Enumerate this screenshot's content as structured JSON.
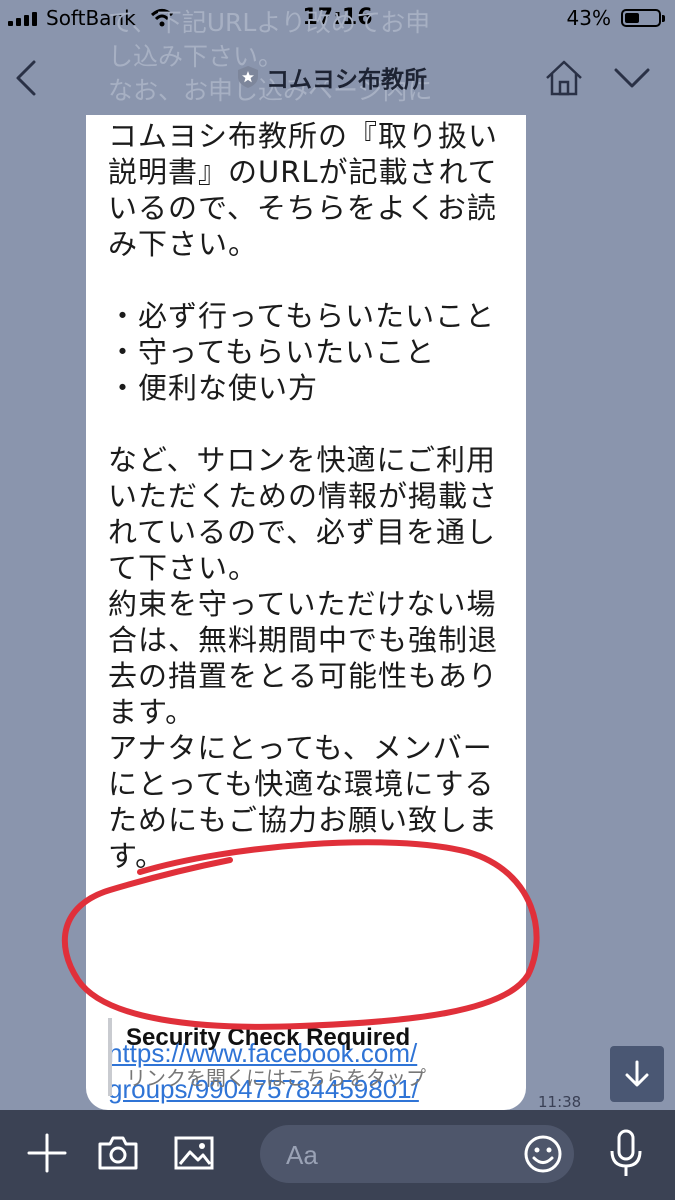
{
  "status": {
    "carrier": "SoftBank",
    "time": "17:16",
    "battery": "43%",
    "battery_level": 0.43
  },
  "header": {
    "ghost_lines": [
      "て、下記URLより改めてお申",
      "し込み下さい。",
      "なお、お申し込みページ内に"
    ],
    "title": "コムヨシ布教所"
  },
  "message": {
    "lines": [
      "コムヨシ布教所の『取り扱い",
      "説明書』のURLが記載されて",
      "いるので、そちらをよくお読",
      "み下さい。",
      "",
      "・必ず行ってもらいたいこと",
      "・守ってもらいたいこと",
      "・便利な使い方",
      "",
      "など、サロンを快適にご利用",
      "いただくための情報が掲載さ",
      "れているので、必ず目を通し",
      "て下さい。",
      "約束を守っていただけない場",
      "合は、無料期間中でも強制退",
      "去の措置をとる可能性もあり",
      "ます。",
      "アナタにとっても、メンバー",
      "にとっても快適な環境にする",
      "ためにもご協力お願い致しま",
      "す。"
    ],
    "link_line1": "https://www.facebook.com/",
    "link_line2": "groups/990475784459801/",
    "preview_title": "Security Check Required",
    "preview_sub": "リンクを開くにはこちらをタップ",
    "time": "11:38"
  },
  "composer": {
    "placeholder": "Aa"
  },
  "colors": {
    "background": "#8a95ad",
    "bubble": "#ffffff",
    "link": "#2f74d6",
    "annotation": "#e0303a",
    "composer": "#3b4254"
  }
}
